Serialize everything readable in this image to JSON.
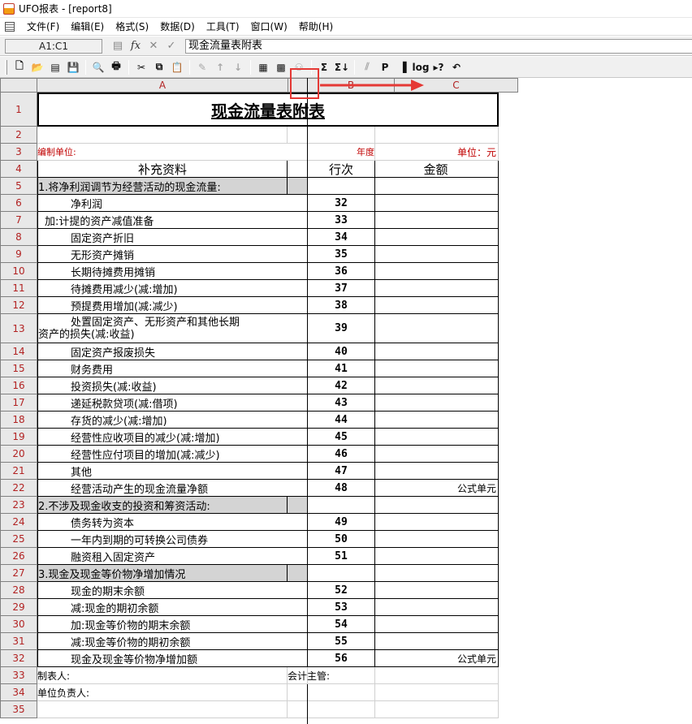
{
  "window": {
    "title": "UFO报表 - [report8]"
  },
  "menu": [
    "文件(F)",
    "编辑(E)",
    "格式(S)",
    "数据(D)",
    "工具(T)",
    "窗口(W)",
    "帮助(H)"
  ],
  "formula_bar": {
    "cell_ref": "A1:C1",
    "content": "现金流量表附表"
  },
  "toolbar": {
    "buttons": [
      {
        "name": "new-icon",
        "glyph": "🗋",
        "enabled": true
      },
      {
        "name": "open-icon",
        "glyph": "📂",
        "enabled": true
      },
      {
        "name": "page-icon",
        "glyph": "▤",
        "enabled": true
      },
      {
        "name": "save-icon",
        "glyph": "💾",
        "enabled": true
      },
      {
        "name": "sep"
      },
      {
        "name": "print-preview-icon",
        "glyph": "🔍",
        "enabled": true
      },
      {
        "name": "print-icon",
        "glyph": "🖶",
        "enabled": true
      },
      {
        "name": "sep"
      },
      {
        "name": "cut-icon",
        "glyph": "✂",
        "enabled": true
      },
      {
        "name": "copy-icon",
        "glyph": "⧉",
        "enabled": true
      },
      {
        "name": "paste-icon",
        "glyph": "📋",
        "enabled": true
      },
      {
        "name": "sep"
      },
      {
        "name": "format-brush-icon",
        "glyph": "✎",
        "enabled": false
      },
      {
        "name": "sort-asc-icon",
        "glyph": "↑",
        "enabled": false
      },
      {
        "name": "sort-desc-icon",
        "glyph": "↓",
        "enabled": false
      },
      {
        "name": "sep"
      },
      {
        "name": "insert-table-icon",
        "glyph": "▦",
        "enabled": true
      },
      {
        "name": "grid-icon",
        "glyph": "▩",
        "enabled": true
      },
      {
        "name": "find-icon",
        "glyph": "⚇",
        "enabled": false
      },
      {
        "name": "sep"
      },
      {
        "name": "sum-icon",
        "glyph": "Σ",
        "enabled": true
      },
      {
        "name": "sum-down-icon",
        "glyph": "Σ↓",
        "enabled": true
      },
      {
        "name": "sep"
      },
      {
        "name": "chart-icon",
        "glyph": "⫽",
        "enabled": false
      },
      {
        "name": "p-icon",
        "glyph": "P",
        "enabled": true
      },
      {
        "name": "fill-icon",
        "glyph": "▐",
        "enabled": true
      },
      {
        "name": "log-icon",
        "glyph": "log",
        "enabled": true
      },
      {
        "name": "help-icon",
        "glyph": "▸?",
        "enabled": true
      },
      {
        "name": "undo-icon",
        "glyph": "↶",
        "enabled": true
      }
    ]
  },
  "columns": [
    "A",
    "B",
    "C"
  ],
  "sheet": {
    "title": "现金流量表附表",
    "unit_label": "编制单位:",
    "year_label": "年度",
    "currency_label": "单位：元",
    "headers": [
      "补充资料",
      "行次",
      "金额"
    ],
    "footer_preparer": "制表人:",
    "footer_accountant": "会计主管:",
    "footer_manager": "单位负责人:",
    "formula_unit": "公式单元"
  },
  "rows": [
    {
      "n": "1",
      "type": "title"
    },
    {
      "n": "2",
      "type": "blank"
    },
    {
      "n": "3",
      "type": "meta"
    },
    {
      "n": "4",
      "type": "header"
    },
    {
      "n": "5",
      "type": "section",
      "label": "1.将净利润调节为经营活动的现金流量:"
    },
    {
      "n": "6",
      "type": "item",
      "label": "净利润",
      "indent": 40,
      "line": "32"
    },
    {
      "n": "7",
      "type": "item",
      "label": "加:计提的资产减值准备",
      "indent": 8,
      "line": "33"
    },
    {
      "n": "8",
      "type": "item",
      "label": "固定资产折旧",
      "indent": 40,
      "line": "34"
    },
    {
      "n": "9",
      "type": "item",
      "label": "无形资产摊销",
      "indent": 40,
      "line": "35"
    },
    {
      "n": "10",
      "type": "item",
      "label": "长期待摊费用摊销",
      "indent": 40,
      "line": "36"
    },
    {
      "n": "11",
      "type": "item",
      "label": "待摊费用减少(减:增加)",
      "indent": 40,
      "line": "37"
    },
    {
      "n": "12",
      "type": "item",
      "label": "预提费用增加(减:减少)",
      "indent": 40,
      "line": "38"
    },
    {
      "n": "13",
      "type": "item2",
      "label": "处置固定资产、无形资产和其他长期",
      "label2": "资产的损失(减:收益)",
      "indent": 40,
      "line": "39"
    },
    {
      "n": "14",
      "type": "item",
      "label": "固定资产报废损失",
      "indent": 40,
      "line": "40"
    },
    {
      "n": "15",
      "type": "item",
      "label": "财务费用",
      "indent": 40,
      "line": "41"
    },
    {
      "n": "16",
      "type": "item",
      "label": "投资损失(减:收益)",
      "indent": 40,
      "line": "42"
    },
    {
      "n": "17",
      "type": "item",
      "label": "递延税款贷项(减:借项)",
      "indent": 40,
      "line": "43"
    },
    {
      "n": "18",
      "type": "item",
      "label": "存货的减少(减:增加)",
      "indent": 40,
      "line": "44"
    },
    {
      "n": "19",
      "type": "item",
      "label": "经营性应收项目的减少(减:增加)",
      "indent": 40,
      "line": "45"
    },
    {
      "n": "20",
      "type": "item",
      "label": "经营性应付项目的增加(减:减少)",
      "indent": 40,
      "line": "46"
    },
    {
      "n": "21",
      "type": "item",
      "label": "其他",
      "indent": 40,
      "line": "47"
    },
    {
      "n": "22",
      "type": "item",
      "label": "经营活动产生的现金流量净额",
      "indent": 40,
      "line": "48",
      "amount": "公式单元"
    },
    {
      "n": "23",
      "type": "section",
      "label": "2.不涉及现金收支的投资和筹资活动:"
    },
    {
      "n": "24",
      "type": "item",
      "label": "债务转为资本",
      "indent": 40,
      "line": "49"
    },
    {
      "n": "25",
      "type": "item",
      "label": "一年内到期的可转换公司债券",
      "indent": 40,
      "line": "50"
    },
    {
      "n": "26",
      "type": "item",
      "label": "融资租入固定资产",
      "indent": 40,
      "line": "51"
    },
    {
      "n": "27",
      "type": "section",
      "label": "3.现金及现金等价物净增加情况"
    },
    {
      "n": "28",
      "type": "item",
      "label": "现金的期末余额",
      "indent": 40,
      "line": "52"
    },
    {
      "n": "29",
      "type": "item",
      "label": "减:现金的期初余额",
      "indent": 40,
      "line": "53"
    },
    {
      "n": "30",
      "type": "item",
      "label": "加:现金等价物的期末余额",
      "indent": 40,
      "line": "54"
    },
    {
      "n": "31",
      "type": "item",
      "label": "减:现金等价物的期初余额",
      "indent": 40,
      "line": "55"
    },
    {
      "n": "32",
      "type": "item",
      "label": "现金及现金等价物净增加额",
      "indent": 40,
      "line": "56",
      "amount": "公式单元"
    },
    {
      "n": "33",
      "type": "footer1"
    },
    {
      "n": "34",
      "type": "footer2"
    },
    {
      "n": "35",
      "type": "blank"
    }
  ]
}
